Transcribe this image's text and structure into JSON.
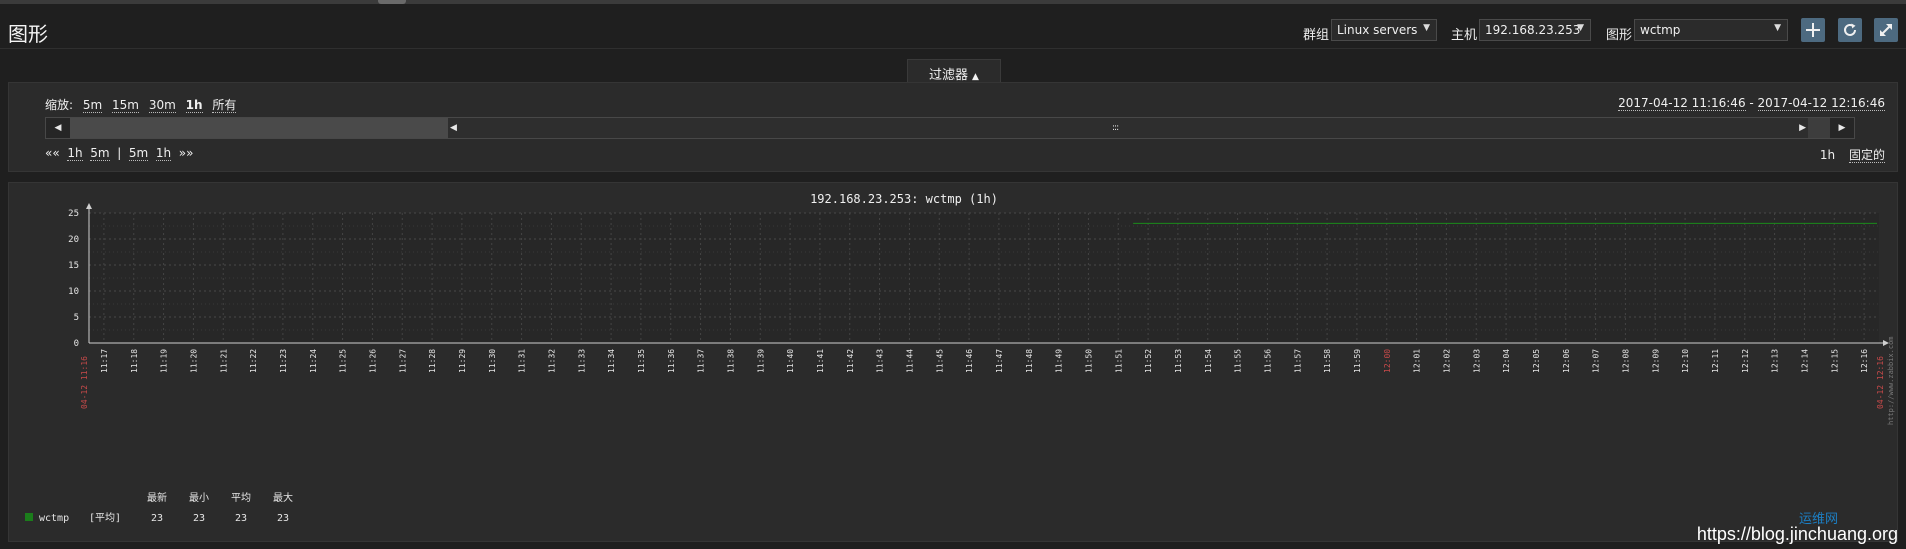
{
  "header": {
    "title": "图形",
    "group_label": "群组",
    "group_value": "Linux servers",
    "host_label": "主机",
    "host_value": "192.168.23.253",
    "graph_label": "图形",
    "graph_value": "wctmp"
  },
  "filter": {
    "tab_label": "过滤器",
    "zoom_label": "缩放:",
    "zoom_options": [
      "5m",
      "15m",
      "30m",
      "1h",
      "所有"
    ],
    "zoom_selected": "1h",
    "period_from": "2017-04-12 11:16:46",
    "period_sep": " - ",
    "period_to": "2017-04-12 12:16:46",
    "nav_back": "««",
    "nav_back_1": "1h",
    "nav_back_2": "5m",
    "nav_sep": "|",
    "nav_fwd_1": "5m",
    "nav_fwd_2": "1h",
    "nav_fwd": "»»",
    "period_value": "1h",
    "fixed_label": "固定的"
  },
  "graph": {
    "title": "192.168.23.253: wctmp (1h)",
    "legend": {
      "headers": [
        "最新",
        "最小",
        "平均",
        "最大"
      ],
      "item_name": "wctmp",
      "item_func": "[平均]",
      "values": [
        "23",
        "23",
        "23",
        "23"
      ],
      "item_color": "#1b7d1b"
    },
    "side_text": "http://www.zabbix.com",
    "start_label": "04-12 11:16",
    "end_label": "04-12 12:16"
  },
  "watermark": "https://blog.jinchuang.org",
  "logo_text": "运维网",
  "chart_data": {
    "type": "line",
    "title": "192.168.23.253: wctmp (1h)",
    "xlabel": "",
    "ylabel": "",
    "ylim": [
      0,
      25
    ],
    "y_ticks": [
      0,
      5,
      10,
      15,
      20,
      25
    ],
    "x_ticks": [
      "11:17",
      "11:18",
      "11:19",
      "11:20",
      "11:21",
      "11:22",
      "11:23",
      "11:24",
      "11:25",
      "11:26",
      "11:27",
      "11:28",
      "11:29",
      "11:30",
      "11:31",
      "11:32",
      "11:33",
      "11:34",
      "11:35",
      "11:36",
      "11:37",
      "11:38",
      "11:39",
      "11:40",
      "11:41",
      "11:42",
      "11:43",
      "11:44",
      "11:45",
      "11:46",
      "11:47",
      "11:48",
      "11:49",
      "11:50",
      "11:51",
      "11:52",
      "11:53",
      "11:54",
      "11:55",
      "11:56",
      "11:57",
      "11:58",
      "11:59",
      "12:00",
      "12:01",
      "12:02",
      "12:03",
      "12:04",
      "12:05",
      "12:06",
      "12:07",
      "12:08",
      "12:09",
      "12:10",
      "12:11",
      "12:12",
      "12:13",
      "12:14",
      "12:15",
      "12:16"
    ],
    "highlight_tick": "12:00",
    "grid": true,
    "series": [
      {
        "name": "wctmp",
        "color": "#1b8a1b",
        "x": [
          "11:52",
          "12:16"
        ],
        "values": [
          23,
          23
        ]
      }
    ]
  }
}
